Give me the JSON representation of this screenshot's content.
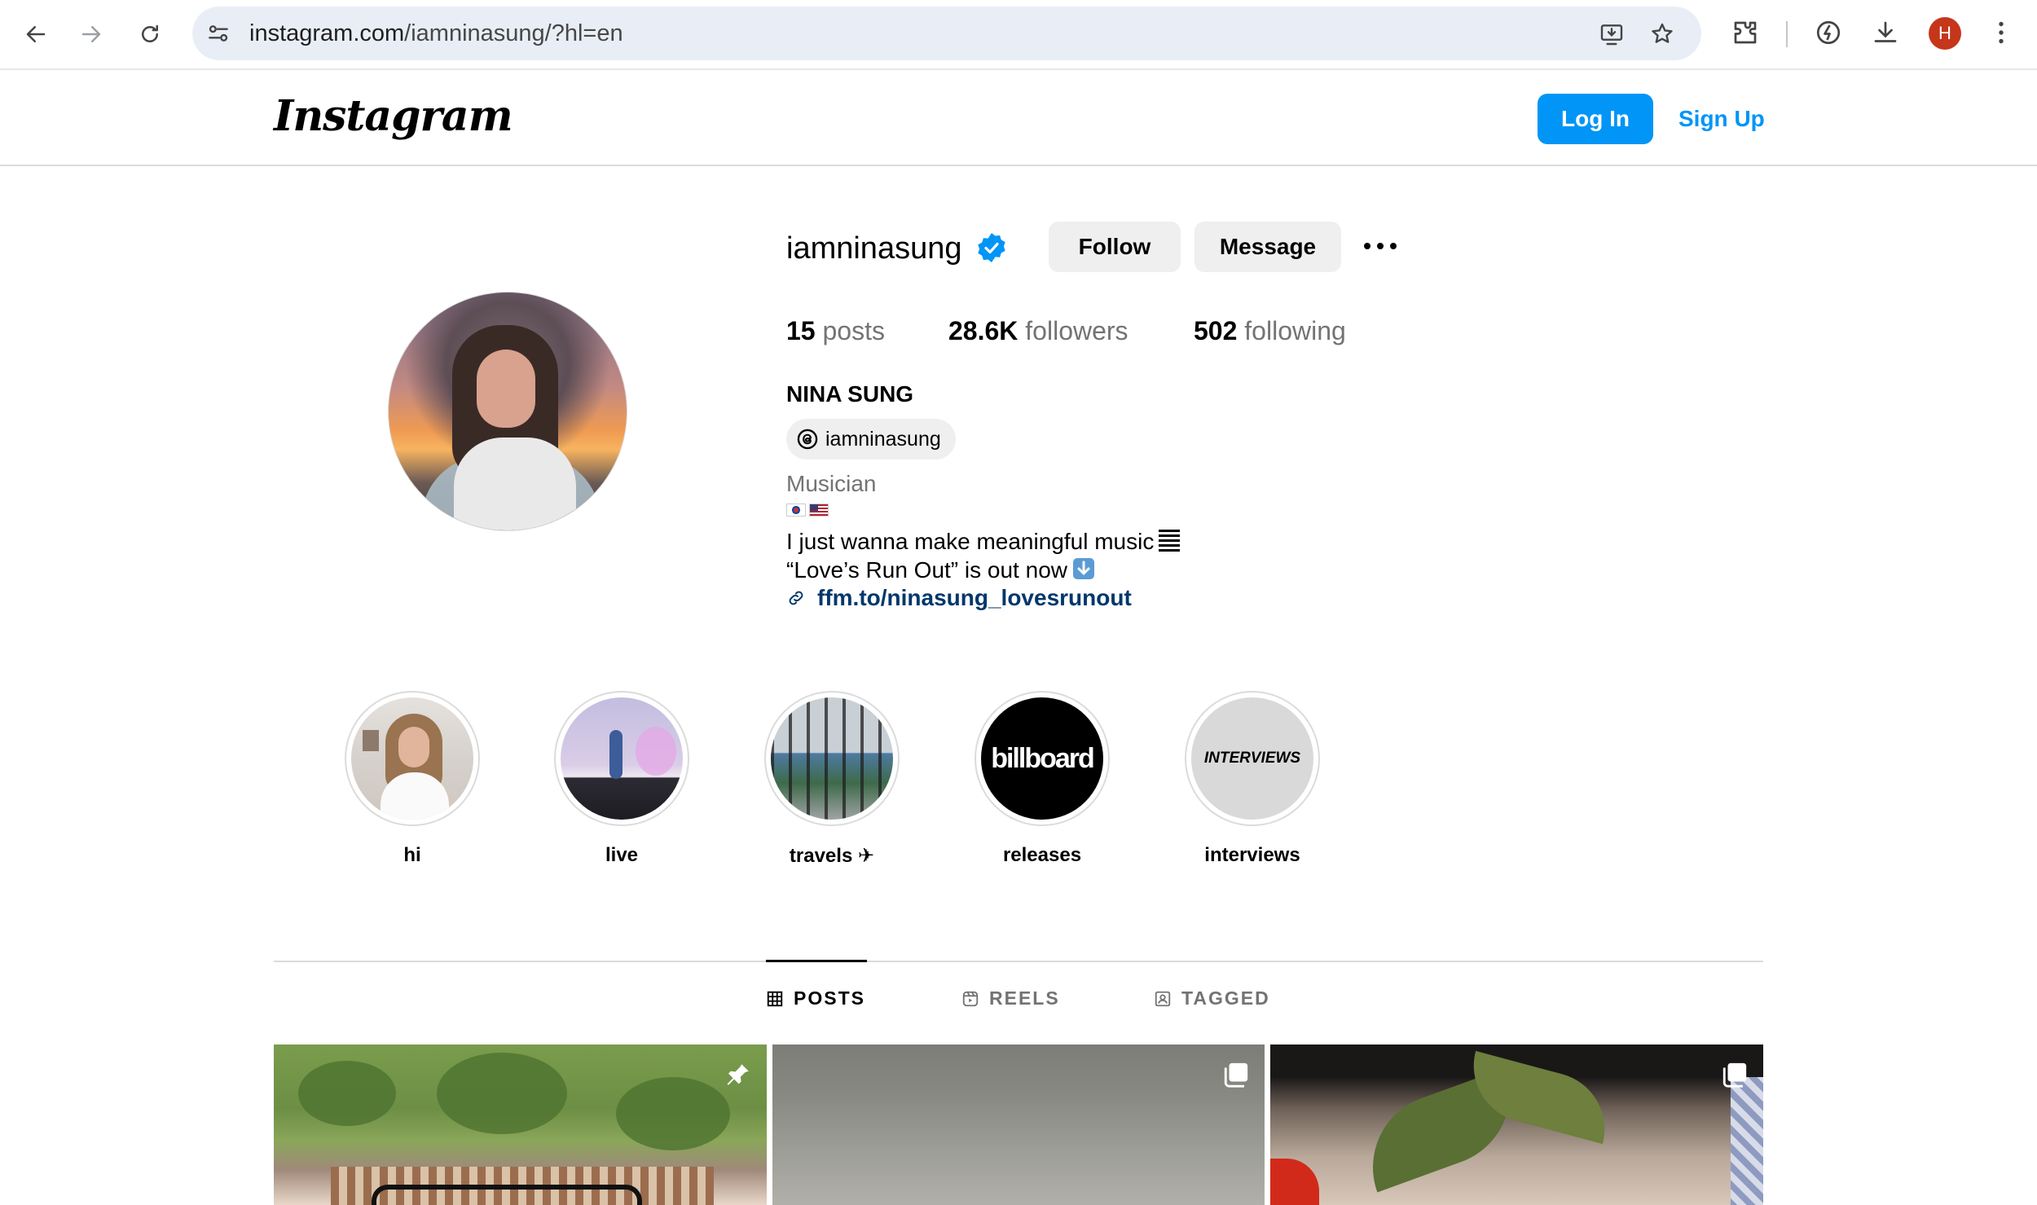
{
  "browser": {
    "url_domain": "instagram.com",
    "url_path": "/iamninasung/?hl=en",
    "profile_initial": "H",
    "accent_color": "#c5361b"
  },
  "header": {
    "logo": "Instagram",
    "login_label": "Log In",
    "signup_label": "Sign Up",
    "brand_color": "#0095f6"
  },
  "profile": {
    "username": "iamninasung",
    "verified": true,
    "follow_label": "Follow",
    "message_label": "Message",
    "stats": {
      "posts_count": "15",
      "posts_label": "posts",
      "followers_count": "28.6K",
      "followers_label": "followers",
      "following_count": "502",
      "following_label": "following"
    },
    "full_name": "NINA SUNG",
    "threads_handle": "iamninasung",
    "category": "Musician",
    "flags": [
      "kr-flag",
      "us-flag"
    ],
    "bio_line1": "I just wanna make meaningful music",
    "bio_line1_emoji": "sound-bars-emoji",
    "bio_line2": "“Love’s Run Out” is out now",
    "bio_line2_emoji": "down-arrow-emoji",
    "link": "ffm.to/ninasung_lovesrunout"
  },
  "highlights": [
    {
      "label": "hi"
    },
    {
      "label": "live"
    },
    {
      "label": "travels ✈"
    },
    {
      "label": "releases",
      "cover_text": "billboard"
    },
    {
      "label": "interviews",
      "cover_text": "INTERVIEWS"
    }
  ],
  "tabs": [
    {
      "label": "POSTS",
      "active": true,
      "icon": "grid-icon"
    },
    {
      "label": "REELS",
      "active": false,
      "icon": "reels-icon"
    },
    {
      "label": "TAGGED",
      "active": false,
      "icon": "tagged-icon"
    }
  ],
  "posts": [
    {
      "badge": "pin-icon"
    },
    {
      "badge": "carousel-icon"
    },
    {
      "badge": "carousel-icon"
    }
  ]
}
